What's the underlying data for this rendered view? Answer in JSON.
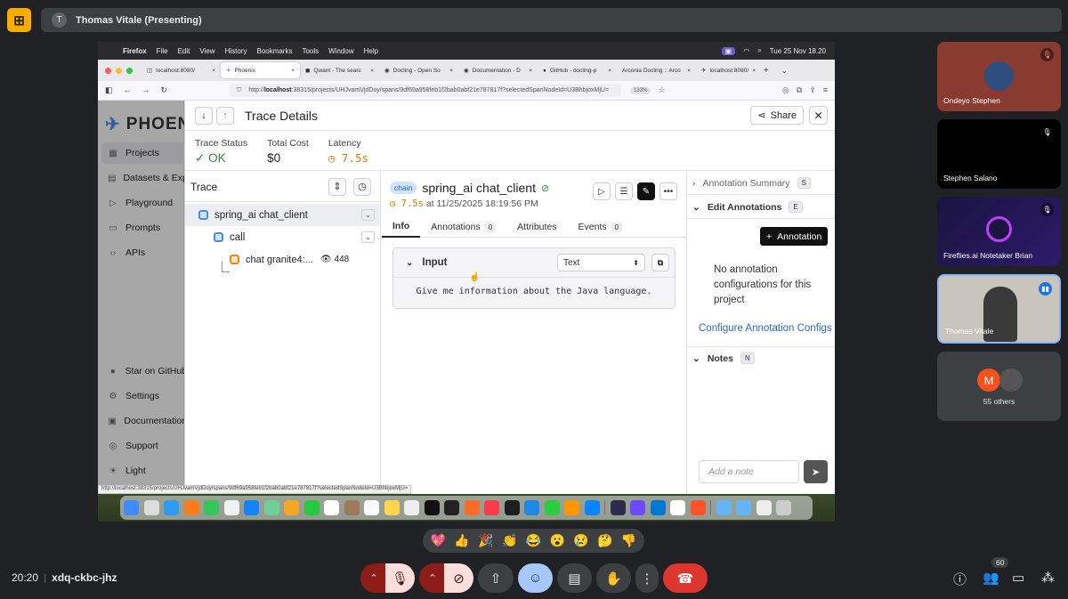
{
  "meet": {
    "presenter_title": "Thomas Vitale (Presenting)",
    "presenter_initial": "T",
    "clock": "20:20",
    "meeting_code": "xdq-ckbc-jhz",
    "participant_count": "60",
    "reactions": [
      "💖",
      "👍",
      "🎉",
      "👏",
      "😂",
      "😮",
      "😢",
      "🤔",
      "👎"
    ]
  },
  "participants": [
    {
      "name": "Ondeyo Stephen",
      "muted": true
    },
    {
      "name": "Stephen Salano",
      "muted": true
    },
    {
      "name": "Fireflies.ai Notetaker Brian",
      "muted": true
    },
    {
      "name": "Thomas Vitale",
      "muted": false
    },
    {
      "name": "55 others",
      "initial": "M"
    }
  ],
  "mac": {
    "menu": [
      "Firefox",
      "File",
      "Edit",
      "View",
      "History",
      "Bookmarks",
      "Tools",
      "Window",
      "Help"
    ],
    "datetime": "Tue 25 Nov  18.20"
  },
  "browser": {
    "tabs": [
      {
        "title": "localhost:8080/",
        "active": false
      },
      {
        "title": "Phoenix",
        "active": true
      },
      {
        "title": "Qwant - The searc",
        "active": false
      },
      {
        "title": "Docling - Open So",
        "active": false
      },
      {
        "title": "Documentation - D",
        "active": false
      },
      {
        "title": "GitHub - docling-p",
        "active": false
      },
      {
        "title": "Arconia Docling :: Arco",
        "active": false
      },
      {
        "title": "localhost:8080/",
        "active": false
      }
    ],
    "url_prefix": "http://",
    "url_host": "localhost",
    "url_rest": ":38315/projects/UHJvamVjdDoy/spans/9df69a958feb1f2bab0abf21e787817f?selectedSpanNodeId=U3BhbjoxMjU=",
    "zoom": "133%",
    "status_url": "http://localhost:38315/projects/UHJvamVjdDoy/spans/9df69a958feb1f2bab0abf21e787817f?selectedSpanNodeId=U3BhbjoxMjU="
  },
  "phoenix": {
    "logo": "PHOENIX",
    "nav": [
      {
        "label": "Projects",
        "icon": "grid-icon"
      },
      {
        "label": "Datasets & Experiments",
        "icon": "database-icon"
      },
      {
        "label": "Playground",
        "icon": "play-icon"
      },
      {
        "label": "Prompts",
        "icon": "chat-icon"
      },
      {
        "label": "APIs",
        "icon": "code-icon"
      }
    ],
    "nav_bottom": [
      {
        "label": "Star on GitHub",
        "icon": "github-icon"
      },
      {
        "label": "Settings",
        "icon": "gear-icon"
      },
      {
        "label": "Documentation",
        "icon": "book-icon"
      },
      {
        "label": "Support",
        "icon": "support-icon"
      },
      {
        "label": "Light",
        "icon": "sun-icon"
      }
    ]
  },
  "trace": {
    "title": "Trace Details",
    "share_label": "Share",
    "stats": [
      {
        "label": "Trace Status",
        "value": "OK"
      },
      {
        "label": "Total Cost",
        "value": "$0"
      },
      {
        "label": "Latency",
        "value": "7.5s"
      }
    ],
    "tree_title": "Trace",
    "tree": [
      {
        "label": "spring_ai chat_client"
      },
      {
        "label": "call"
      },
      {
        "label": "chat granite4:...",
        "tokens": "448"
      }
    ]
  },
  "span": {
    "kind": "chain",
    "name": "spring_ai chat_client",
    "latency": "7.5s",
    "timestamp": "at 11/25/2025 18:19:56 PM",
    "tabs": [
      {
        "label": "Info",
        "count": ""
      },
      {
        "label": "Annotations",
        "count": "0"
      },
      {
        "label": "Attributes",
        "count": ""
      },
      {
        "label": "Events",
        "count": "0"
      }
    ],
    "input_title": "Input",
    "format": "Text",
    "input_text": "Give me information about the Java language."
  },
  "annotations": {
    "summary_label": "Annotation Summary",
    "summary_key": "S",
    "edit_label": "Edit Annotations",
    "edit_key": "E",
    "add_button": "Annotation",
    "empty_text": "No annotation configurations for this project",
    "config_link": "Configure Annotation Configs",
    "notes_label": "Notes",
    "notes_key": "N",
    "note_placeholder": "Add a note"
  }
}
